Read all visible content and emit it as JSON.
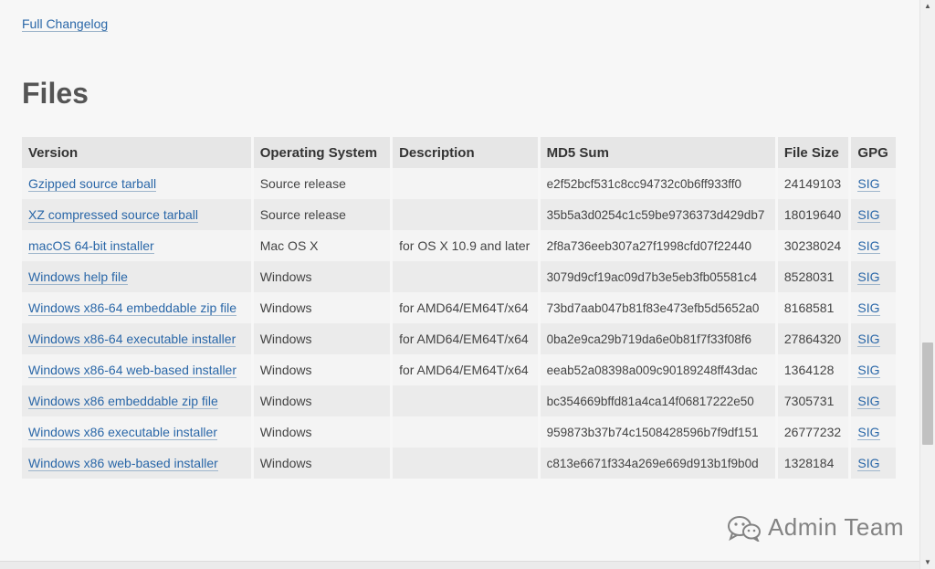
{
  "changelog_link": "Full Changelog",
  "section_title": "Files",
  "table": {
    "headers": [
      "Version",
      "Operating System",
      "Description",
      "MD5 Sum",
      "File Size",
      "GPG"
    ],
    "rows": [
      {
        "version": "Gzipped source tarball",
        "os": "Source release",
        "description": "",
        "md5": "e2f52bcf531c8cc94732c0b6ff933ff0",
        "size": "24149103",
        "gpg": "SIG"
      },
      {
        "version": "XZ compressed source tarball",
        "os": "Source release",
        "description": "",
        "md5": "35b5a3d0254c1c59be9736373d429db7",
        "size": "18019640",
        "gpg": "SIG"
      },
      {
        "version": "macOS 64-bit installer",
        "os": "Mac OS X",
        "description": "for OS X 10.9 and later",
        "md5": "2f8a736eeb307a27f1998cfd07f22440",
        "size": "30238024",
        "gpg": "SIG"
      },
      {
        "version": "Windows help file",
        "os": "Windows",
        "description": "",
        "md5": "3079d9cf19ac09d7b3e5eb3fb05581c4",
        "size": "8528031",
        "gpg": "SIG"
      },
      {
        "version": "Windows x86-64 embeddable zip file",
        "os": "Windows",
        "description": "for AMD64/EM64T/x64",
        "md5": "73bd7aab047b81f83e473efb5d5652a0",
        "size": "8168581",
        "gpg": "SIG"
      },
      {
        "version": "Windows x86-64 executable installer",
        "os": "Windows",
        "description": "for AMD64/EM64T/x64",
        "md5": "0ba2e9ca29b719da6e0b81f7f33f08f6",
        "size": "27864320",
        "gpg": "SIG"
      },
      {
        "version": "Windows x86-64 web-based installer",
        "os": "Windows",
        "description": "for AMD64/EM64T/x64",
        "md5": "eeab52a08398a009c90189248ff43dac",
        "size": "1364128",
        "gpg": "SIG"
      },
      {
        "version": "Windows x86 embeddable zip file",
        "os": "Windows",
        "description": "",
        "md5": "bc354669bffd81a4ca14f06817222e50",
        "size": "7305731",
        "gpg": "SIG"
      },
      {
        "version": "Windows x86 executable installer",
        "os": "Windows",
        "description": "",
        "md5": "959873b37b74c1508428596b7f9df151",
        "size": "26777232",
        "gpg": "SIG"
      },
      {
        "version": "Windows x86 web-based installer",
        "os": "Windows",
        "description": "",
        "md5": "c813e6671f334a269e669d913b1f9b0d",
        "size": "1328184",
        "gpg": "SIG"
      }
    ]
  },
  "watermark": {
    "text": "Admin Team",
    "icon": "wechat-icon"
  },
  "scrollbar": {
    "up_icon": "scroll-up-arrow-icon",
    "down_icon": "scroll-down-arrow-icon"
  },
  "colors": {
    "link": "#2a67a8",
    "header_bg": "#e6e6e6",
    "page_bg": "#f7f7f7"
  }
}
